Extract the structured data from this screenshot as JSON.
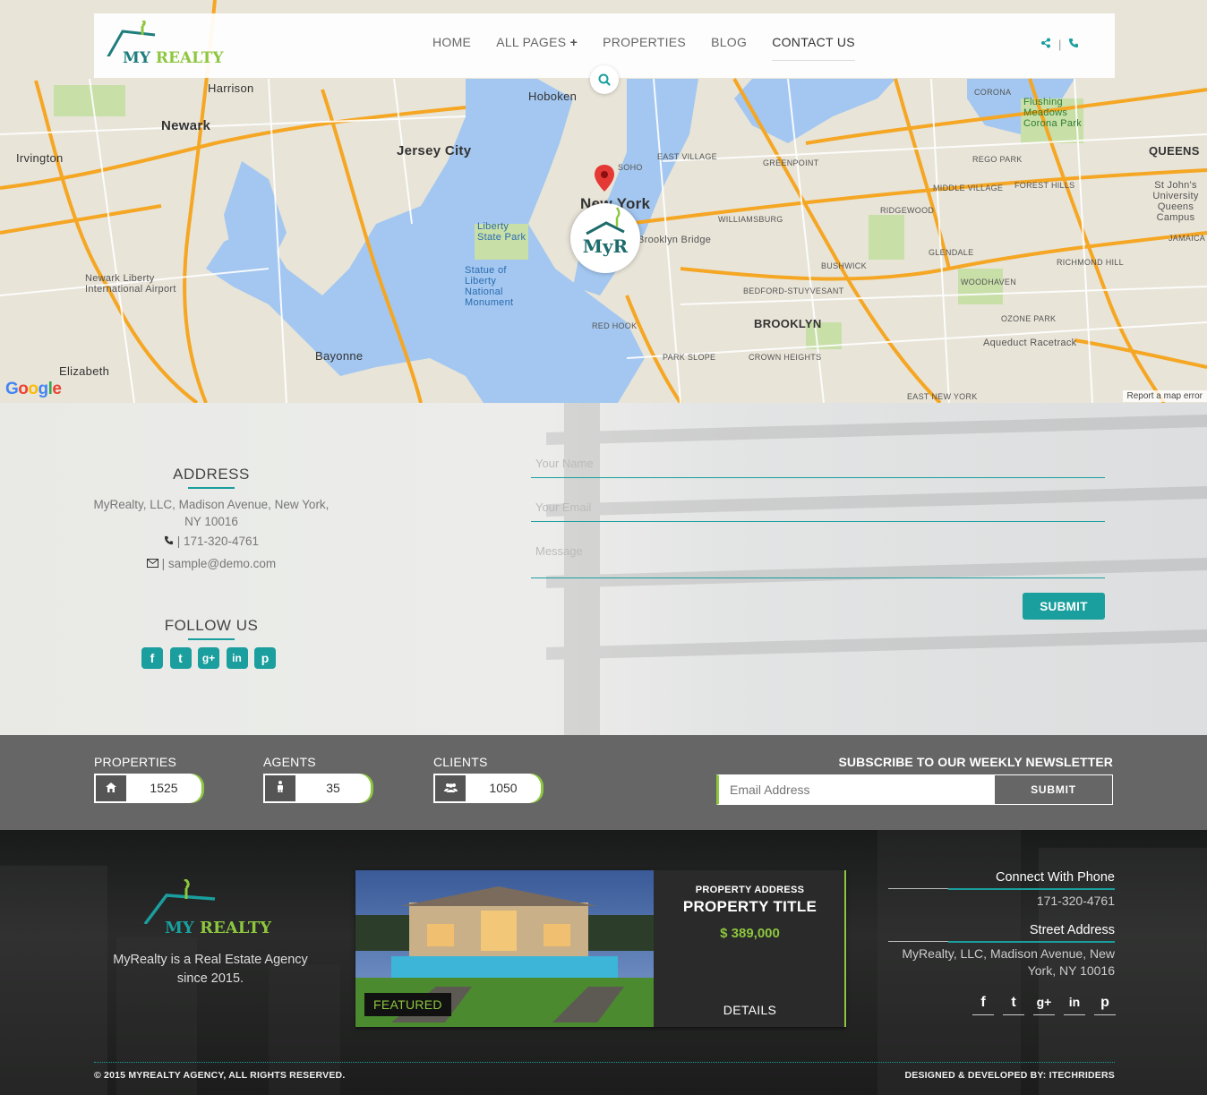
{
  "brand": {
    "name_part1": "MY ",
    "name_part2": "REALTY",
    "badge": "MyR"
  },
  "nav": {
    "items": [
      {
        "label": "HOME"
      },
      {
        "label": "ALL PAGES"
      },
      {
        "label": "PROPERTIES"
      },
      {
        "label": "BLOG"
      },
      {
        "label": "CONTACT US"
      }
    ],
    "plus_icon": "+",
    "share_icon": "share-icon",
    "phone_icon": "phone-icon",
    "separator": "|",
    "search_icon": "search-icon"
  },
  "map": {
    "labels": {
      "newark": "Newark",
      "jersey_city": "Jersey City",
      "hoboken": "Hoboken",
      "new_york": "New York",
      "brooklyn": "BROOKLYN",
      "queens": "QUEENS",
      "bayonne": "Bayonne",
      "elizabeth": "Elizabeth",
      "irvington": "Irvington",
      "harrison": "Harrison",
      "liberty": "Liberty State Park",
      "statue": "Statue of Liberty National Monument",
      "airport": "Newark Liberty International Airport",
      "williamsburg": "WILLIAMSBURG",
      "greenpoint": "GREENPOINT",
      "bushwick": "BUSHWICK",
      "ridgewood": "RIDGEWOOD",
      "glendale": "GLENDALE",
      "woodhaven": "WOODHAVEN",
      "richmond_hill": "RICHMOND HILL",
      "ozone_park": "OZONE PARK",
      "red_hook": "RED HOOK",
      "park_slope": "PARK SLOPE",
      "crown_heights": "CROWN HEIGHTS",
      "flushing": "Flushing Meadows Corona Park",
      "aqueduct": "Aqueduct Racetrack",
      "brooklyn_bridge": "Brooklyn Bridge",
      "east_village": "EAST VILLAGE",
      "soho": "SOHO",
      "east_new_york": "EAST NEW YORK",
      "bed_stuy": "BEDFORD-STUYVESANT",
      "corona": "CORONA",
      "rego_park": "REGO PARK",
      "forest_hills": "FOREST HILLS",
      "middle_village": "MIDDLE VILLAGE",
      "jamaica": "JAMAICA",
      "st_johns": "St John's University Queens Campus"
    },
    "google": [
      "G",
      "o",
      "o",
      "g",
      "l",
      "e"
    ],
    "report": "Report a map error"
  },
  "contact": {
    "address_title": "ADDRESS",
    "address": "MyRealty, LLC, Madison Avenue, New York, NY 10016",
    "phone": "| 171-320-4761",
    "email": "| sample@demo.com",
    "follow_title": "FOLLOW US",
    "social": [
      "f",
      "t",
      "g+",
      "in",
      "p"
    ],
    "form": {
      "name_placeholder": "Your Name",
      "email_placeholder": "Your Email",
      "message_placeholder": "Message",
      "submit_label": "SUBMIT"
    }
  },
  "stats": {
    "items": [
      {
        "label": "PROPERTIES",
        "value": "1525",
        "icon": "home-icon"
      },
      {
        "label": "AGENTS",
        "value": "35",
        "icon": "user-icon"
      },
      {
        "label": "CLIENTS",
        "value": "1050",
        "icon": "users-icon"
      }
    ],
    "newsletter_title": "SUBSCRIBE TO OUR WEEKLY NEWSLETTER",
    "newsletter_placeholder": "Email Address",
    "newsletter_button": "SUBMIT"
  },
  "footer": {
    "description": "MyRealty is a Real Estate Agency since 2015.",
    "featured": {
      "tag": "FEATURED",
      "address_label": "PROPERTY ADDRESS",
      "title": "PROPERTY TITLE",
      "price": "$ 389,000",
      "details": "DETAILS"
    },
    "phone_title": "Connect With Phone",
    "phone": "171-320-4761",
    "street_title": "Street Address",
    "street": "MyRealty, LLC, Madison Avenue, New York, NY 10016",
    "social": [
      "f",
      "t",
      "g+",
      "in",
      "p"
    ],
    "copyright": "© 2015 MYREALTY AGENCY, ALL RIGHTS RESERVED.",
    "credit": "DESIGNED & DEVELOPED BY: ITECHRIDERS"
  },
  "colors": {
    "accent": "#1a9e9e",
    "lime": "#8dc63f",
    "stats_bg": "#666666",
    "footer_bg": "#1f201f"
  }
}
